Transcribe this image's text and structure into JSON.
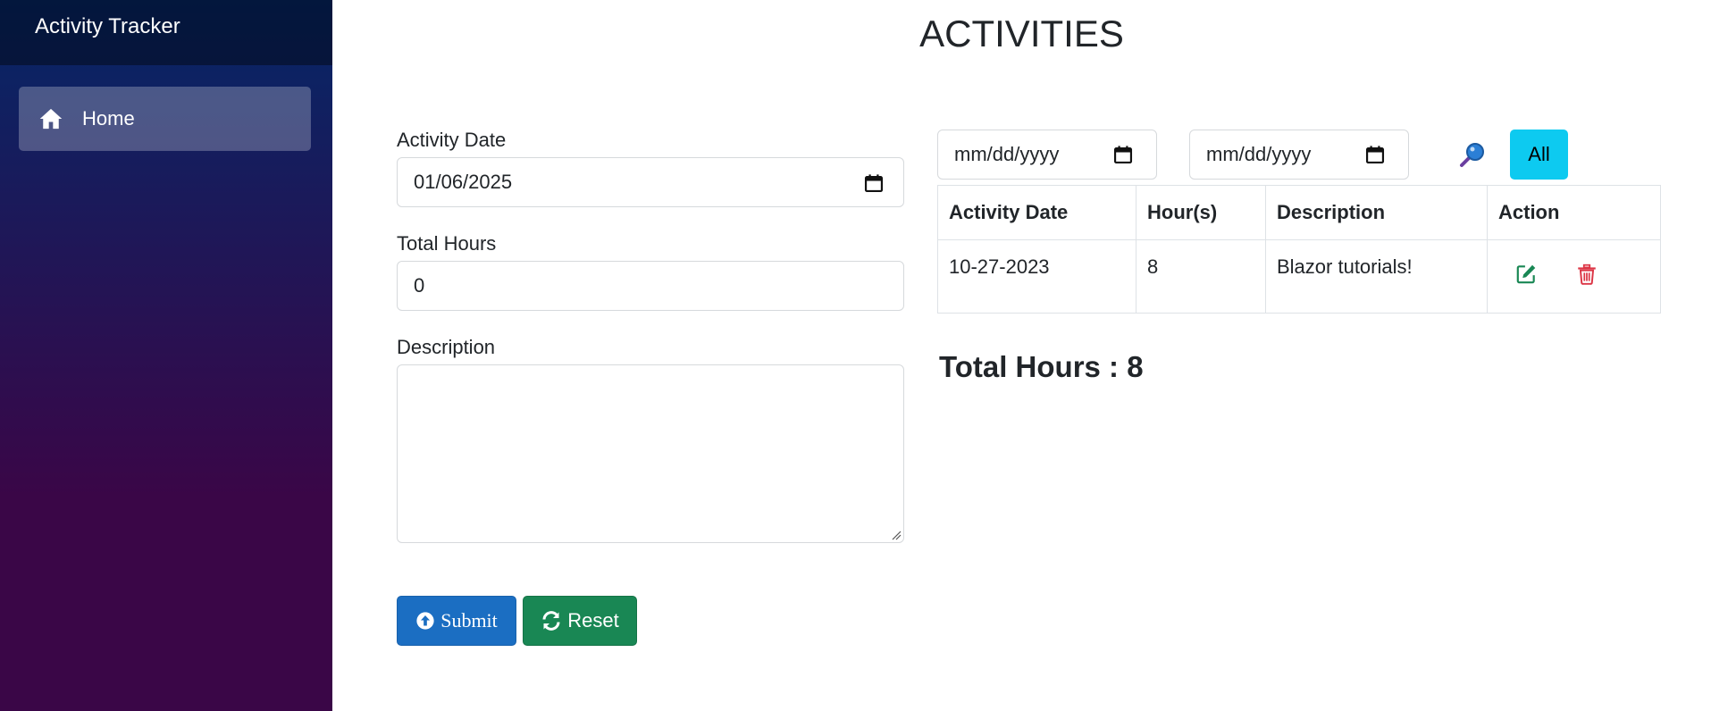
{
  "app": {
    "title": "Activity Tracker"
  },
  "sidebar": {
    "items": [
      {
        "label": "Home",
        "icon": "home-icon"
      }
    ]
  },
  "page": {
    "title": "ACTIVITIES"
  },
  "form": {
    "activity_date_label": "Activity Date",
    "activity_date_value": "01/06/2025",
    "total_hours_label": "Total Hours",
    "total_hours_value": "0",
    "description_label": "Description",
    "description_value": "",
    "submit_label": "Submit",
    "reset_label": "Reset"
  },
  "filter": {
    "from_placeholder": "mm/dd/yyyy",
    "to_placeholder": "mm/dd/yyyy",
    "all_label": "All"
  },
  "table": {
    "headers": [
      "Activity Date",
      "Hour(s)",
      "Description",
      "Action"
    ],
    "rows": [
      {
        "date": "10-27-2023",
        "hours": "8",
        "description": "Blazor tutorials!"
      }
    ]
  },
  "summary": {
    "total_text": "Total Hours : 8"
  },
  "colors": {
    "sidebar_top": "#052767",
    "sidebar_bottom": "#3a0647",
    "submit": "#1b6ec2",
    "reset": "#198754",
    "all": "#0dcaf0",
    "edit": "#198754",
    "delete": "#dc3545"
  }
}
